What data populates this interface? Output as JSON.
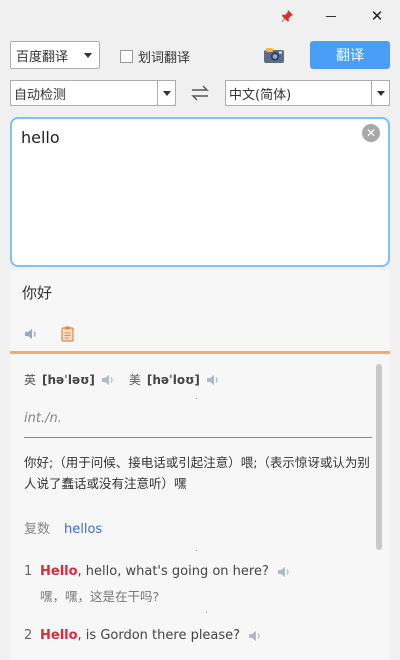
{
  "window": {
    "pin_icon": "pin-icon",
    "minimize_icon": "minimize-icon",
    "close_icon": "close-icon",
    "close_glyph": "✕"
  },
  "toolbar": {
    "engine": "百度翻译",
    "word_select_label": "划词翻译",
    "word_select_checked": false,
    "screenshot_icon": "camera-icon",
    "translate_label": "翻译",
    "accent_color": "#4a9ef5"
  },
  "languages": {
    "source": "自动检测",
    "target": "中文(简体)",
    "swap_icon": "swap-arrows-icon"
  },
  "input": {
    "text": "hello",
    "clear_glyph": "✕"
  },
  "result": {
    "text": "你好",
    "speaker_icon": "speaker-icon",
    "copy_icon": "copy-icon"
  },
  "dictionary": {
    "uk_label": "英",
    "uk_phonetic": "[həˈləʊ]",
    "us_label": "美",
    "us_phonetic": "[həˈloʊ]",
    "part_of_speech": "int./n.",
    "definition": "你好;（用于问候、接电话或引起注意）喂;（表示惊讶或认为别人说了蠢话或没有注意听）嘿",
    "plural_label": "复数",
    "plural_word": "hellos",
    "examples": [
      {
        "num": "1",
        "keyword": "Hello",
        "rest": ", hello, what's going on here?",
        "translation": "嘿，嘿，这是在干吗?"
      },
      {
        "num": "2",
        "keyword": "Hello",
        "rest": ", is Gordon there please?",
        "translation": ""
      }
    ]
  }
}
